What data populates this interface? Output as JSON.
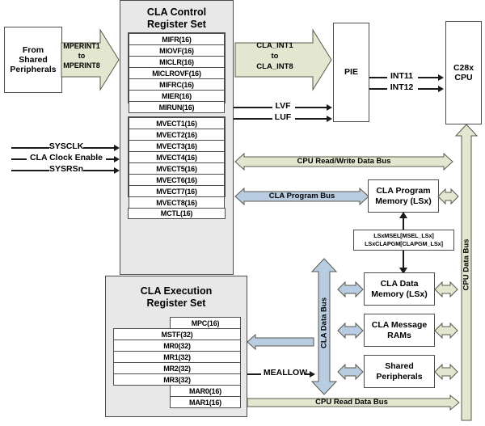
{
  "diagram": {
    "title": "CLA Block Diagram",
    "colors": {
      "cpu_bus": "#e4e7d0",
      "cla_bus": "#b9cde2",
      "panel": "#e8e8e8",
      "box": "#ffffff",
      "stroke": "#4d4d4d",
      "line": "#1a1a1a"
    }
  },
  "source_box": {
    "label": "From\nShared\nPeripherals",
    "line1": "From",
    "line2": "Shared",
    "line3": "Peripherals"
  },
  "mperint_arrow": {
    "line1": "MPERINT1",
    "line2": "to",
    "line3": "MPERINT8"
  },
  "control_panel": {
    "title_line1": "CLA Control",
    "title_line2": "Register Set",
    "flag_registers": [
      "MIFR(16)",
      "MIOVF(16)",
      "MICLR(16)",
      "MICLROVF(16)",
      "MIFRC(16)",
      "MIER(16)",
      "MIRUN(16)"
    ],
    "vector_registers": [
      "MVECT1(16)",
      "MVECT2(16)",
      "MVECT3(16)",
      "MVECT4(16)",
      "MVECT5(16)",
      "MVECT6(16)",
      "MVECT7(16)",
      "MVECT8(16)"
    ],
    "control_register": "MCTL(16)"
  },
  "execution_panel": {
    "title_line1": "CLA Execution",
    "title_line2": "Register Set",
    "registers": [
      {
        "name": "MPC(16)",
        "align": "right"
      },
      {
        "name": "MSTF(32)",
        "align": "left"
      },
      {
        "name": "MR0(32)",
        "align": "left"
      },
      {
        "name": "MR1(32)",
        "align": "left"
      },
      {
        "name": "MR2(32)",
        "align": "left"
      },
      {
        "name": "MR3(32)",
        "align": "left"
      },
      {
        "name": "MAR0(16)",
        "align": "right"
      },
      {
        "name": "MAR1(16)",
        "align": "right"
      }
    ]
  },
  "clock_signals": [
    {
      "label": "SYSCLK"
    },
    {
      "label": "CLA Clock Enable"
    },
    {
      "label": "SYSRSn"
    }
  ],
  "cla_int_arrow": {
    "line1": "CLA_INT1",
    "line2": "to",
    "line3": "CLA_INT8"
  },
  "flag_signals": [
    {
      "label": "LVF"
    },
    {
      "label": "LUF"
    }
  ],
  "pie_box": {
    "label": "PIE"
  },
  "cpu_box": {
    "line1": "C28x",
    "line2": "CPU"
  },
  "interrupt_signals": [
    {
      "label": "INT11"
    },
    {
      "label": "INT12"
    }
  ],
  "buses": {
    "cpu_read_write_data": "CPU Read/Write Data Bus",
    "cla_program": "CLA Program Bus",
    "cla_data": "CLA Data Bus",
    "cpu_data": "CPU Data Bus",
    "cpu_read_data": "CPU Read Data Bus"
  },
  "memory_blocks": [
    {
      "line1": "CLA Program",
      "line2": "Memory (LSx)"
    },
    {
      "line1": "CLA Data",
      "line2": "Memory (LSx)"
    },
    {
      "line1": "CLA Message",
      "line2": "RAMs"
    },
    {
      "line1": "Shared",
      "line2": "Peripherals"
    }
  ],
  "msel_box": {
    "line1": "LSxMSEL[MSEL_LSx]",
    "line2": "LSxCLAPGM[CLAPGM_LSx]"
  },
  "meallow_signal": {
    "label": "MEALLOW"
  }
}
